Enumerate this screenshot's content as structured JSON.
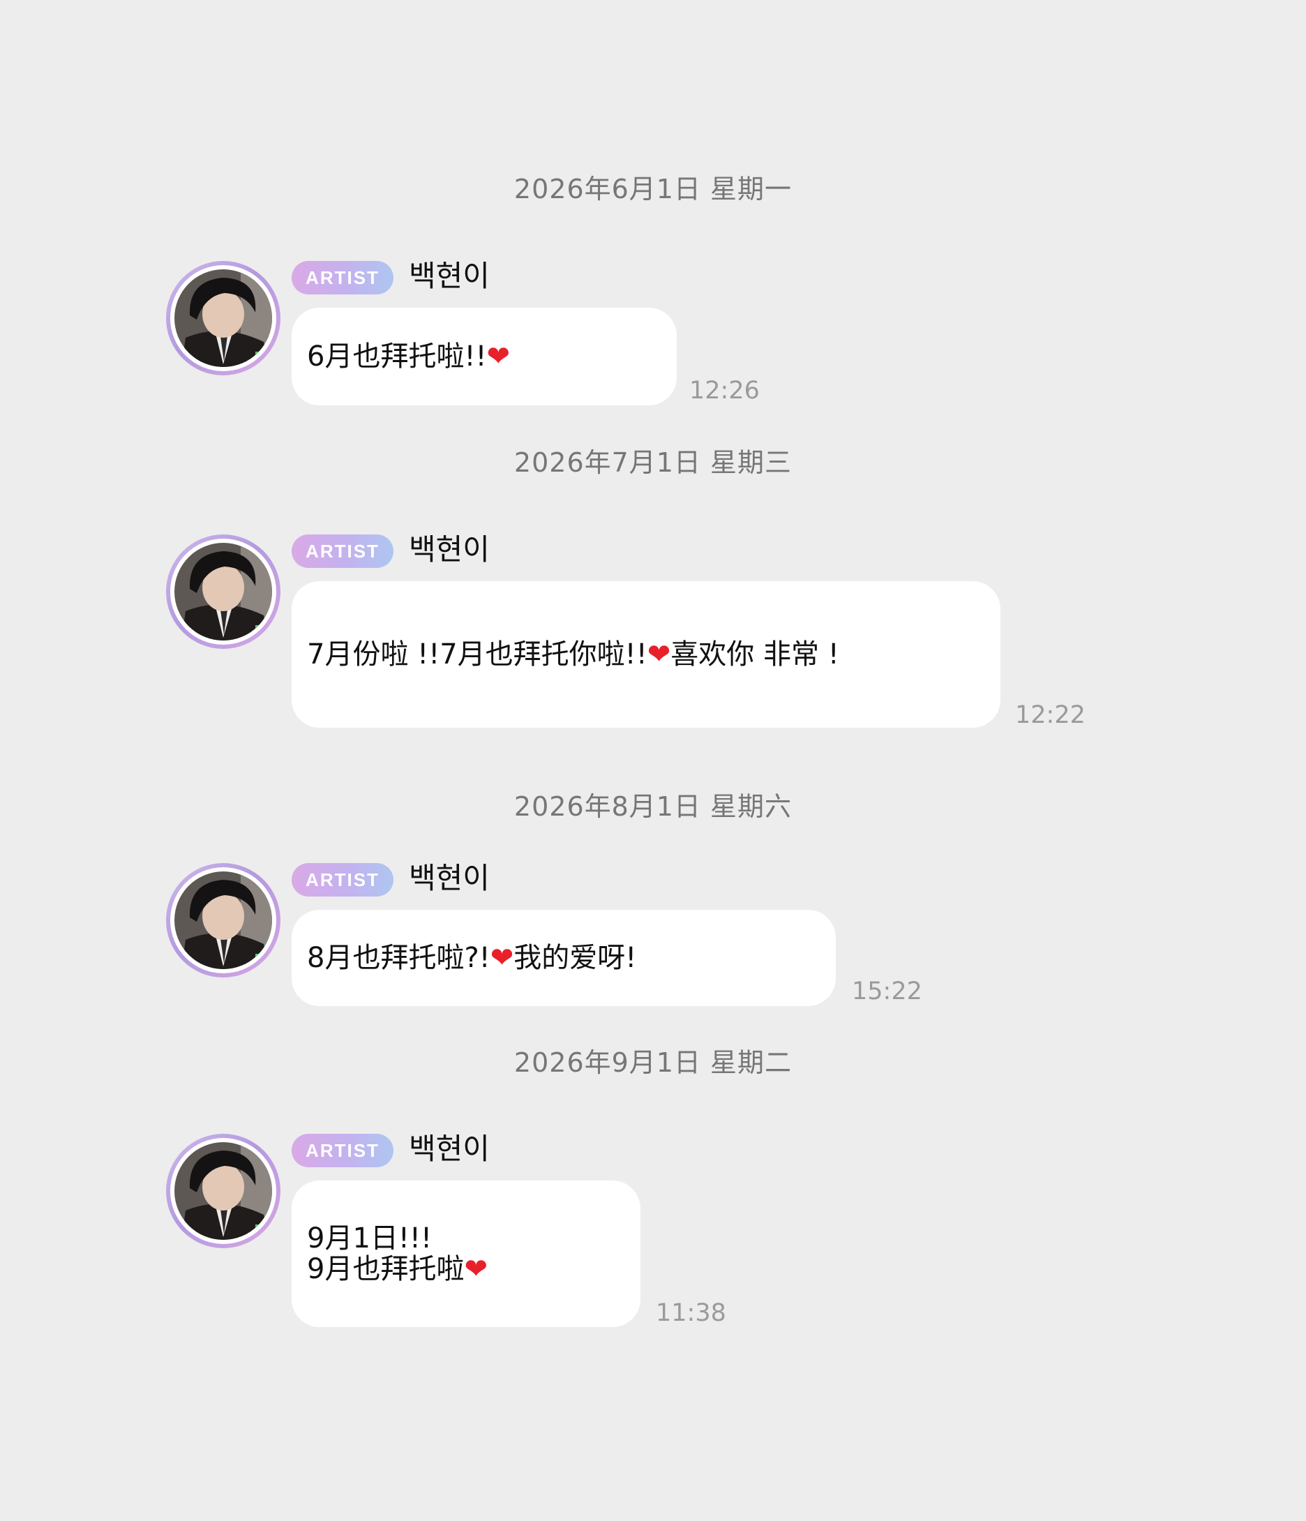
{
  "conversation": {
    "days": [
      {
        "date": "2026年6月1日 星期一",
        "sender": {
          "badge": "ARTIST",
          "name": "백현이"
        },
        "message": {
          "lines": [
            {
              "text": "6月也拜托啦!!",
              "heart": "❤",
              "after": ""
            }
          ]
        },
        "time": "12:26"
      },
      {
        "date": "2026年7月1日 星期三",
        "sender": {
          "badge": "ARTIST",
          "name": "백현이"
        },
        "message": {
          "lines": [
            {
              "text": "7月份啦 !!7月也拜托你啦!!",
              "heart": "❤",
              "after": "喜欢你 非常 !"
            }
          ]
        },
        "time": "12:22"
      },
      {
        "date": "2026年8月1日 星期六",
        "sender": {
          "badge": "ARTIST",
          "name": "백현이"
        },
        "message": {
          "lines": [
            {
              "text": "8月也拜托啦?!",
              "heart": "❤",
              "after": "我的爱呀!"
            }
          ]
        },
        "time": "15:22"
      },
      {
        "date": "2026年9月1日 星期二",
        "sender": {
          "badge": "ARTIST",
          "name": "백현이"
        },
        "message": {
          "lines": [
            {
              "text": "9月1日!!!",
              "heart": "",
              "after": ""
            },
            {
              "text": "9月也拜托啦",
              "heart": "❤",
              "after": ""
            }
          ]
        },
        "time": "11:38"
      }
    ]
  },
  "colors": {
    "background": "#ededed",
    "bubble": "#ffffff",
    "date_text": "#767676",
    "timestamp_text": "#9a9a9a",
    "heart": "#e8202a",
    "badge_gradient_start": "#d9a9e6",
    "badge_gradient_end": "#aec6f1",
    "avatar_ring": "#c3b2ef"
  },
  "icons": {
    "avatar": "profile-photo",
    "heart": "red-heart-emoji"
  }
}
